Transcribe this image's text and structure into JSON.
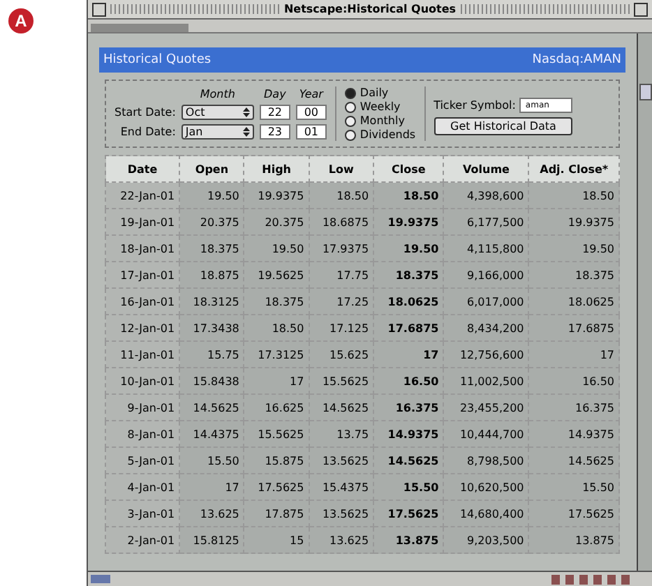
{
  "marker": "A",
  "window": {
    "title": "Netscape:Historical Quotes"
  },
  "header": {
    "title": "Historical Quotes",
    "symbol": "Nasdaq:AMAN"
  },
  "form": {
    "month_label": "Month",
    "day_label": "Day",
    "year_label": "Year",
    "start": {
      "label": "Start Date:",
      "month": "Oct",
      "day": "22",
      "year": "00"
    },
    "end": {
      "label": "End Date:",
      "month": "Jan",
      "day": "23",
      "year": "01"
    },
    "frequency": [
      {
        "label": "Daily",
        "selected": true
      },
      {
        "label": "Weekly",
        "selected": false
      },
      {
        "label": "Monthly",
        "selected": false
      },
      {
        "label": "Dividends",
        "selected": false
      }
    ],
    "ticker_label": "Ticker Symbol:",
    "ticker_value": "aman",
    "button": "Get Historical Data"
  },
  "table": {
    "columns": [
      "Date",
      "Open",
      "High",
      "Low",
      "Close",
      "Volume",
      "Adj. Close*"
    ],
    "rows": [
      [
        "22-Jan-01",
        "19.50",
        "19.9375",
        "18.50",
        "18.50",
        "4,398,600",
        "18.50"
      ],
      [
        "19-Jan-01",
        "20.375",
        "20.375",
        "18.6875",
        "19.9375",
        "6,177,500",
        "19.9375"
      ],
      [
        "18-Jan-01",
        "18.375",
        "19.50",
        "17.9375",
        "19.50",
        "4,115,800",
        "19.50"
      ],
      [
        "17-Jan-01",
        "18.875",
        "19.5625",
        "17.75",
        "18.375",
        "9,166,000",
        "18.375"
      ],
      [
        "16-Jan-01",
        "18.3125",
        "18.375",
        "17.25",
        "18.0625",
        "6,017,000",
        "18.0625"
      ],
      [
        "12-Jan-01",
        "17.3438",
        "18.50",
        "17.125",
        "17.6875",
        "8,434,200",
        "17.6875"
      ],
      [
        "11-Jan-01",
        "15.75",
        "17.3125",
        "15.625",
        "17",
        "12,756,600",
        "17"
      ],
      [
        "10-Jan-01",
        "15.8438",
        "17",
        "15.5625",
        "16.50",
        "11,002,500",
        "16.50"
      ],
      [
        "9-Jan-01",
        "14.5625",
        "16.625",
        "14.5625",
        "16.375",
        "23,455,200",
        "16.375"
      ],
      [
        "8-Jan-01",
        "14.4375",
        "15.5625",
        "13.75",
        "14.9375",
        "10,444,700",
        "14.9375"
      ],
      [
        "5-Jan-01",
        "15.50",
        "15.875",
        "13.5625",
        "14.5625",
        "8,798,500",
        "14.5625"
      ],
      [
        "4-Jan-01",
        "17",
        "17.5625",
        "15.4375",
        "15.50",
        "10,620,500",
        "15.50"
      ],
      [
        "3-Jan-01",
        "13.625",
        "17.875",
        "13.5625",
        "17.5625",
        "14,680,400",
        "17.5625"
      ],
      [
        "2-Jan-01",
        "15.8125",
        "15",
        "13.625",
        "13.875",
        "9,203,500",
        "13.875"
      ]
    ]
  }
}
